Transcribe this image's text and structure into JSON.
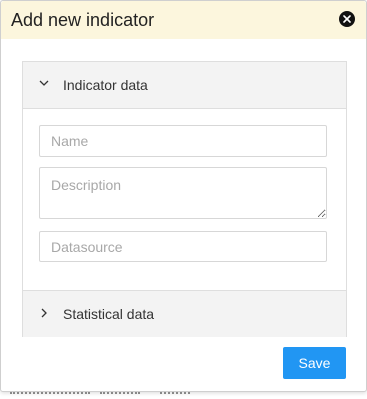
{
  "dialog": {
    "title": "Add new indicator",
    "close_icon": "close-icon"
  },
  "sections": [
    {
      "label": "Indicator data",
      "expanded": true,
      "icon": "chevron-down-icon"
    },
    {
      "label": "Statistical data",
      "expanded": false,
      "icon": "chevron-right-icon"
    }
  ],
  "fields": {
    "name": {
      "placeholder": "Name",
      "value": ""
    },
    "description": {
      "placeholder": "Description",
      "value": ""
    },
    "datasource": {
      "placeholder": "Datasource",
      "value": ""
    }
  },
  "actions": {
    "save_label": "Save"
  },
  "colors": {
    "header_bg": "#fcf6dd",
    "accent": "#2196f3"
  }
}
